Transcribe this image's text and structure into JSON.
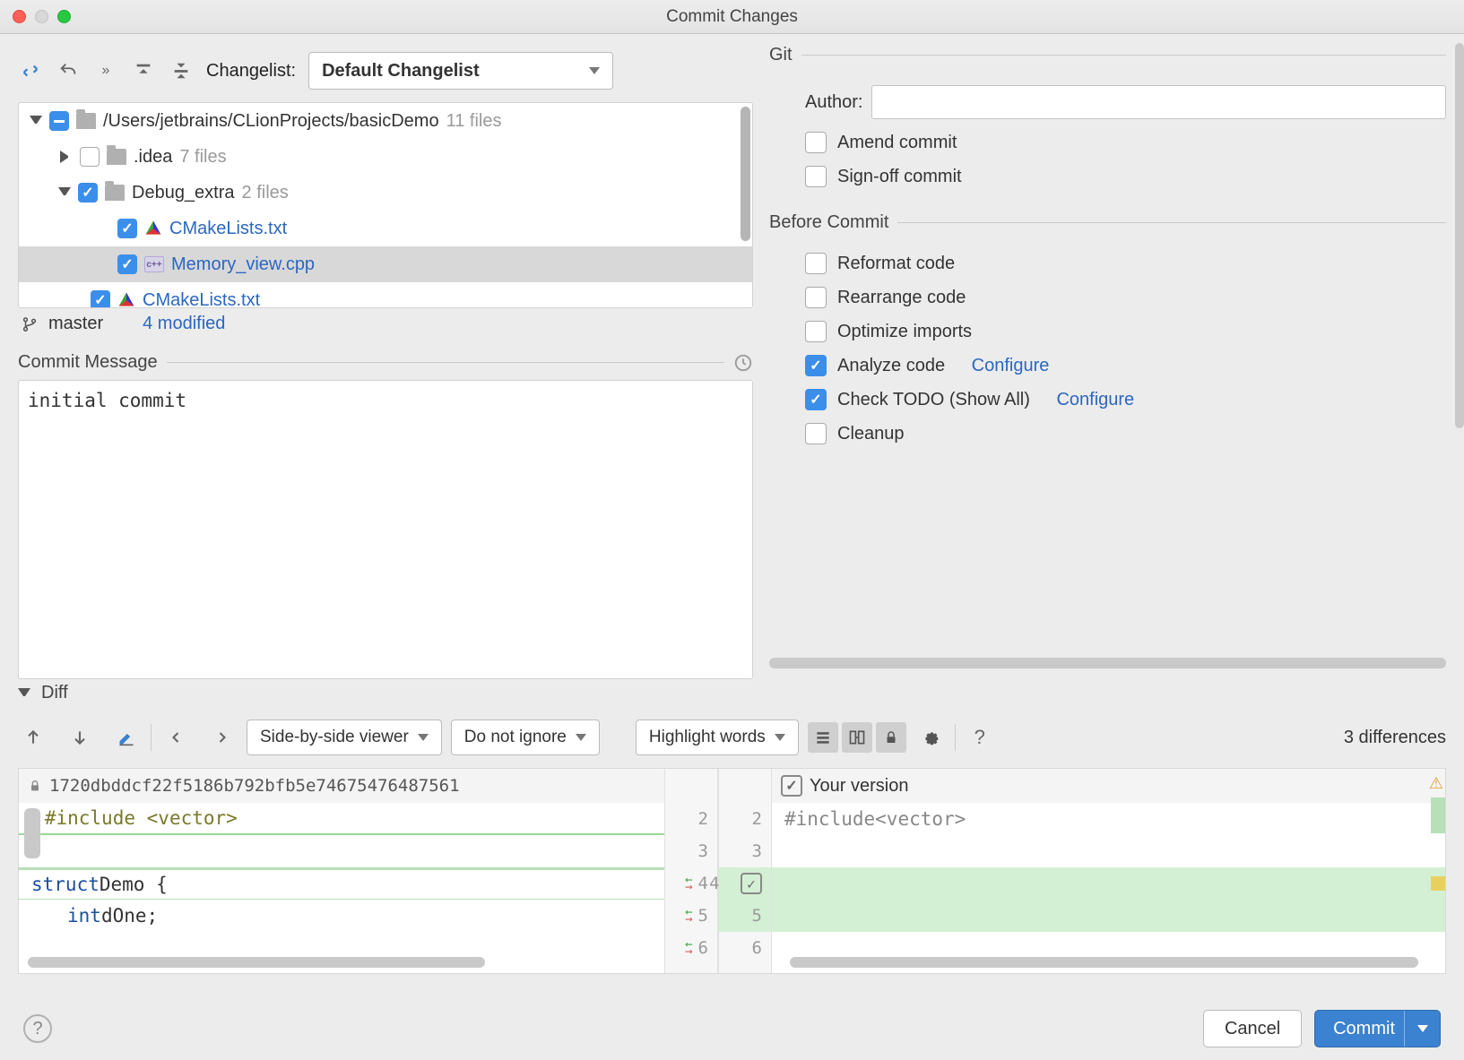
{
  "window": {
    "title": "Commit Changes"
  },
  "toolbar": {
    "changelist_label": "Changelist:",
    "changelist_value": "Default Changelist"
  },
  "tree": {
    "root": {
      "path": "/Users/jetbrains/CLionProjects/basicDemo",
      "count": "11 files"
    },
    "idea": {
      "name": ".idea",
      "count": "7 files"
    },
    "debug_extra": {
      "name": "Debug_extra",
      "count": "2 files"
    },
    "f1": "CMakeLists.txt",
    "f2": "Memory_view.cpp",
    "f3": "CMakeLists.txt"
  },
  "branch": {
    "name": "master",
    "modified": "4 modified"
  },
  "commit": {
    "section": "Commit Message",
    "message": "initial commit"
  },
  "git": {
    "section": "Git",
    "author_label": "Author:",
    "author_value": "",
    "amend": "Amend commit",
    "signoff": "Sign-off commit"
  },
  "before": {
    "section": "Before Commit",
    "reformat": "Reformat code",
    "rearrange": "Rearrange code",
    "optimize": "Optimize imports",
    "analyze": "Analyze code",
    "configure": "Configure",
    "todo": "Check TODO (Show All)",
    "cleanup": "Cleanup"
  },
  "diff": {
    "section": "Diff",
    "view_mode": "Side-by-side viewer",
    "ignore": "Do not ignore",
    "highlight": "Highlight words",
    "count": "3 differences",
    "left_hash": "1720dbddcf22f5186b792bfb5e74675476487561",
    "right_label": "Your version",
    "left_lines": {
      "l1_a": "#include",
      "l1_b": "<vector>",
      "l2_a": "struct",
      "l2_b": " Demo {",
      "l3_a": "int",
      "l3_b": " dOne;"
    },
    "right_lines": {
      "r1_a": "#include",
      "r1_b": " <vector>"
    },
    "gutters": {
      "g2": "2",
      "g3": "3",
      "g4": "4",
      "g5": "5",
      "g6": "6"
    }
  },
  "footer": {
    "cancel": "Cancel",
    "commit": "Commit"
  }
}
